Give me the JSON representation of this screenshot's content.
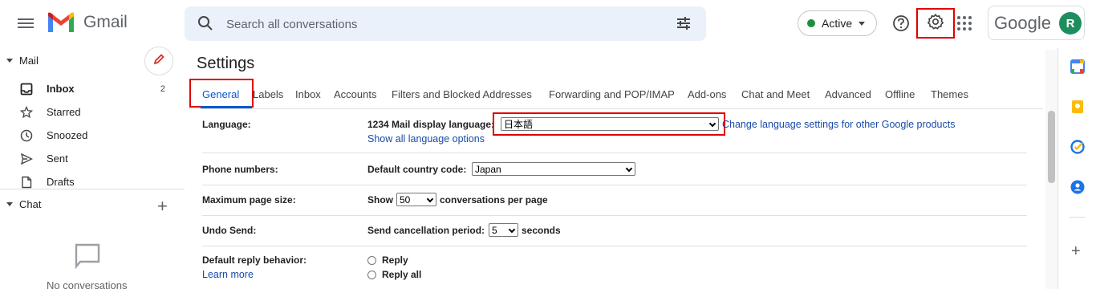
{
  "header": {
    "app_name": "Gmail",
    "search_placeholder": "Search all conversations",
    "status_label": "Active",
    "account_brand": "Google",
    "avatar_initial": "R"
  },
  "sidebar": {
    "mail_heading": "Mail",
    "items": [
      {
        "label": "Inbox",
        "count": "2",
        "icon": "inbox-icon"
      },
      {
        "label": "Starred",
        "icon": "star-icon"
      },
      {
        "label": "Snoozed",
        "icon": "clock-icon"
      },
      {
        "label": "Sent",
        "icon": "send-icon"
      },
      {
        "label": "Drafts",
        "icon": "draft-icon"
      }
    ],
    "chat_heading": "Chat",
    "chat_empty": "No conversations"
  },
  "main": {
    "title": "Settings",
    "tabs": [
      "General",
      "Labels",
      "Inbox",
      "Accounts",
      "Filters and Blocked Addresses",
      "Forwarding and POP/IMAP",
      "Add-ons",
      "Chat and Meet",
      "Advanced",
      "Offline",
      "Themes"
    ],
    "rows": {
      "language": {
        "label": "Language:",
        "text": "1234 Mail display language:",
        "value": "日本語",
        "link": "Change language settings for other Google products",
        "link2": "Show all language options"
      },
      "phone": {
        "label": "Phone numbers:",
        "text": "Default country code:",
        "value": "Japan"
      },
      "page_size": {
        "label": "Maximum page size:",
        "pre": "Show",
        "value": "50",
        "post": "conversations per page"
      },
      "undo": {
        "label": "Undo Send:",
        "pre": "Send cancellation period:",
        "value": "5",
        "post": "seconds"
      },
      "reply": {
        "label": "Default reply behavior:",
        "learn_more": "Learn more",
        "options": [
          "Reply",
          "Reply all"
        ]
      }
    }
  },
  "colors": {
    "accent": "#0b57d0",
    "highlight_box": "#e00000",
    "status_green": "#1e8e3e",
    "avatar": "#1e8e5e"
  }
}
